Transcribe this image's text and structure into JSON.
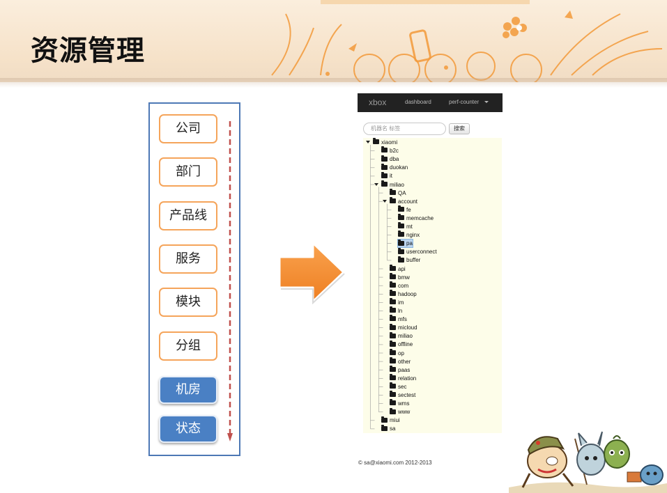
{
  "slide": {
    "title": "资源管理"
  },
  "hierarchy": {
    "items": [
      {
        "label": "公司",
        "style": "outline"
      },
      {
        "label": "部门",
        "style": "outline"
      },
      {
        "label": "产品线",
        "style": "outline"
      },
      {
        "label": "服务",
        "style": "outline"
      },
      {
        "label": "模块",
        "style": "outline"
      },
      {
        "label": "分组",
        "style": "outline"
      },
      {
        "label": "机房",
        "style": "filled"
      },
      {
        "label": "状态",
        "style": "filled"
      }
    ],
    "colors": {
      "outline": "#f5a45a",
      "filled": "#4a80c4",
      "panel_border": "#4d78b5",
      "arrow": "#c0504d"
    }
  },
  "app": {
    "brand": "xbox",
    "nav": {
      "dashboard": "dashboard",
      "perf_counter": "perf-counter"
    },
    "search": {
      "placeholder": "机器名 标签",
      "button": "搜索"
    },
    "tree": [
      {
        "label": "xiaomi",
        "depth": 0,
        "expanded": true
      },
      {
        "label": "b2c",
        "depth": 1
      },
      {
        "label": "dba",
        "depth": 1
      },
      {
        "label": "duokan",
        "depth": 1
      },
      {
        "label": "it",
        "depth": 1
      },
      {
        "label": "miliao",
        "depth": 1,
        "expanded": true
      },
      {
        "label": "QA",
        "depth": 2
      },
      {
        "label": "account",
        "depth": 2,
        "expanded": true
      },
      {
        "label": "fe",
        "depth": 3
      },
      {
        "label": "memcache",
        "depth": 3
      },
      {
        "label": "mt",
        "depth": 3
      },
      {
        "label": "nginx",
        "depth": 3
      },
      {
        "label": "pa",
        "depth": 3,
        "selected": true
      },
      {
        "label": "userconnect",
        "depth": 3
      },
      {
        "label": "buffer",
        "depth": 3
      },
      {
        "label": "api",
        "depth": 2
      },
      {
        "label": "bmw",
        "depth": 2
      },
      {
        "label": "com",
        "depth": 2
      },
      {
        "label": "hadoop",
        "depth": 2
      },
      {
        "label": "im",
        "depth": 2
      },
      {
        "label": "ln",
        "depth": 2
      },
      {
        "label": "mfs",
        "depth": 2
      },
      {
        "label": "micloud",
        "depth": 2
      },
      {
        "label": "miliao",
        "depth": 2
      },
      {
        "label": "offline",
        "depth": 2
      },
      {
        "label": "op",
        "depth": 2
      },
      {
        "label": "other",
        "depth": 2
      },
      {
        "label": "paas",
        "depth": 2
      },
      {
        "label": "relation",
        "depth": 2
      },
      {
        "label": "sec",
        "depth": 2
      },
      {
        "label": "sectest",
        "depth": 2
      },
      {
        "label": "wms",
        "depth": 2
      },
      {
        "label": "www",
        "depth": 2
      },
      {
        "label": "miui",
        "depth": 1
      },
      {
        "label": "sa",
        "depth": 1
      }
    ],
    "footer": "© sa@xiaomi.com 2012-2013",
    "colors": {
      "navbar": "#222222",
      "tree_bg": "#fdfde9",
      "selected": "#bcd5ef"
    }
  },
  "icons": [
    "folder-icon",
    "arrow-right-icon",
    "arrow-down-icon",
    "mascot-image",
    "floral-decoration"
  ]
}
